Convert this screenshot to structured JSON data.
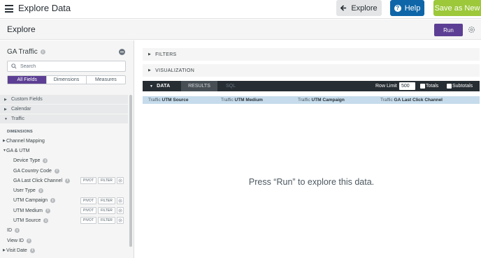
{
  "topbar": {
    "title": "Explore Data",
    "explore_button": "Explore",
    "help_button": "Help",
    "save_as_new_button": "Save as New"
  },
  "subheader": {
    "title": "Explore",
    "run_button": "Run"
  },
  "sidebar": {
    "explore_name": "GA Traffic",
    "search_placeholder": "Search",
    "tabs": [
      "All Fields",
      "Dimensions",
      "Measures"
    ],
    "active_tab": "All Fields",
    "groups": [
      "Custom Fields",
      "Calendar",
      "Traffic"
    ],
    "dimensions_label": "DIMENSIONS",
    "fields": [
      {
        "label": "Channel Mapping",
        "type": "group-collapsed"
      },
      {
        "label": "GA & UTM",
        "type": "group-expanded"
      },
      {
        "label": "Device Type",
        "type": "field"
      },
      {
        "label": "GA Country Code",
        "type": "field"
      },
      {
        "label": "GA Last Click Channel",
        "type": "field-actions"
      },
      {
        "label": "User Type",
        "type": "field"
      },
      {
        "label": "UTM Campaign",
        "type": "field-actions"
      },
      {
        "label": "UTM Medium",
        "type": "field-actions"
      },
      {
        "label": "UTM Source",
        "type": "field-actions"
      },
      {
        "label": "ID",
        "type": "top-field"
      },
      {
        "label": "View ID",
        "type": "top-field"
      },
      {
        "label": "Visit Date",
        "type": "top-group"
      }
    ],
    "pivot_label": "PIVOT",
    "filter_label": "FILTER"
  },
  "main": {
    "filters_label": "FILTERS",
    "visualization_label": "VISUALIZATION",
    "data_tab": "DATA",
    "results_tab": "RESULTS",
    "sql_tab": "SQL",
    "row_limit_label": "Row Limit",
    "row_limit_value": "500",
    "totals_label": "Totals",
    "subtotals_label": "Subtotals",
    "columns": [
      {
        "view": "Traffic",
        "field": "UTM Source"
      },
      {
        "view": "Traffic",
        "field": "UTM Medium"
      },
      {
        "view": "Traffic",
        "field": "UTM Campaign"
      },
      {
        "view": "Traffic",
        "field": "GA Last Click Channel"
      }
    ],
    "empty_message": "Press “Run” to explore this data."
  },
  "colors": {
    "run": "#5c3f94",
    "help": "#0e66a8",
    "save_as_new": "#9cc83a",
    "data_bar": "#262d33",
    "column_header": "#c6dcec"
  }
}
